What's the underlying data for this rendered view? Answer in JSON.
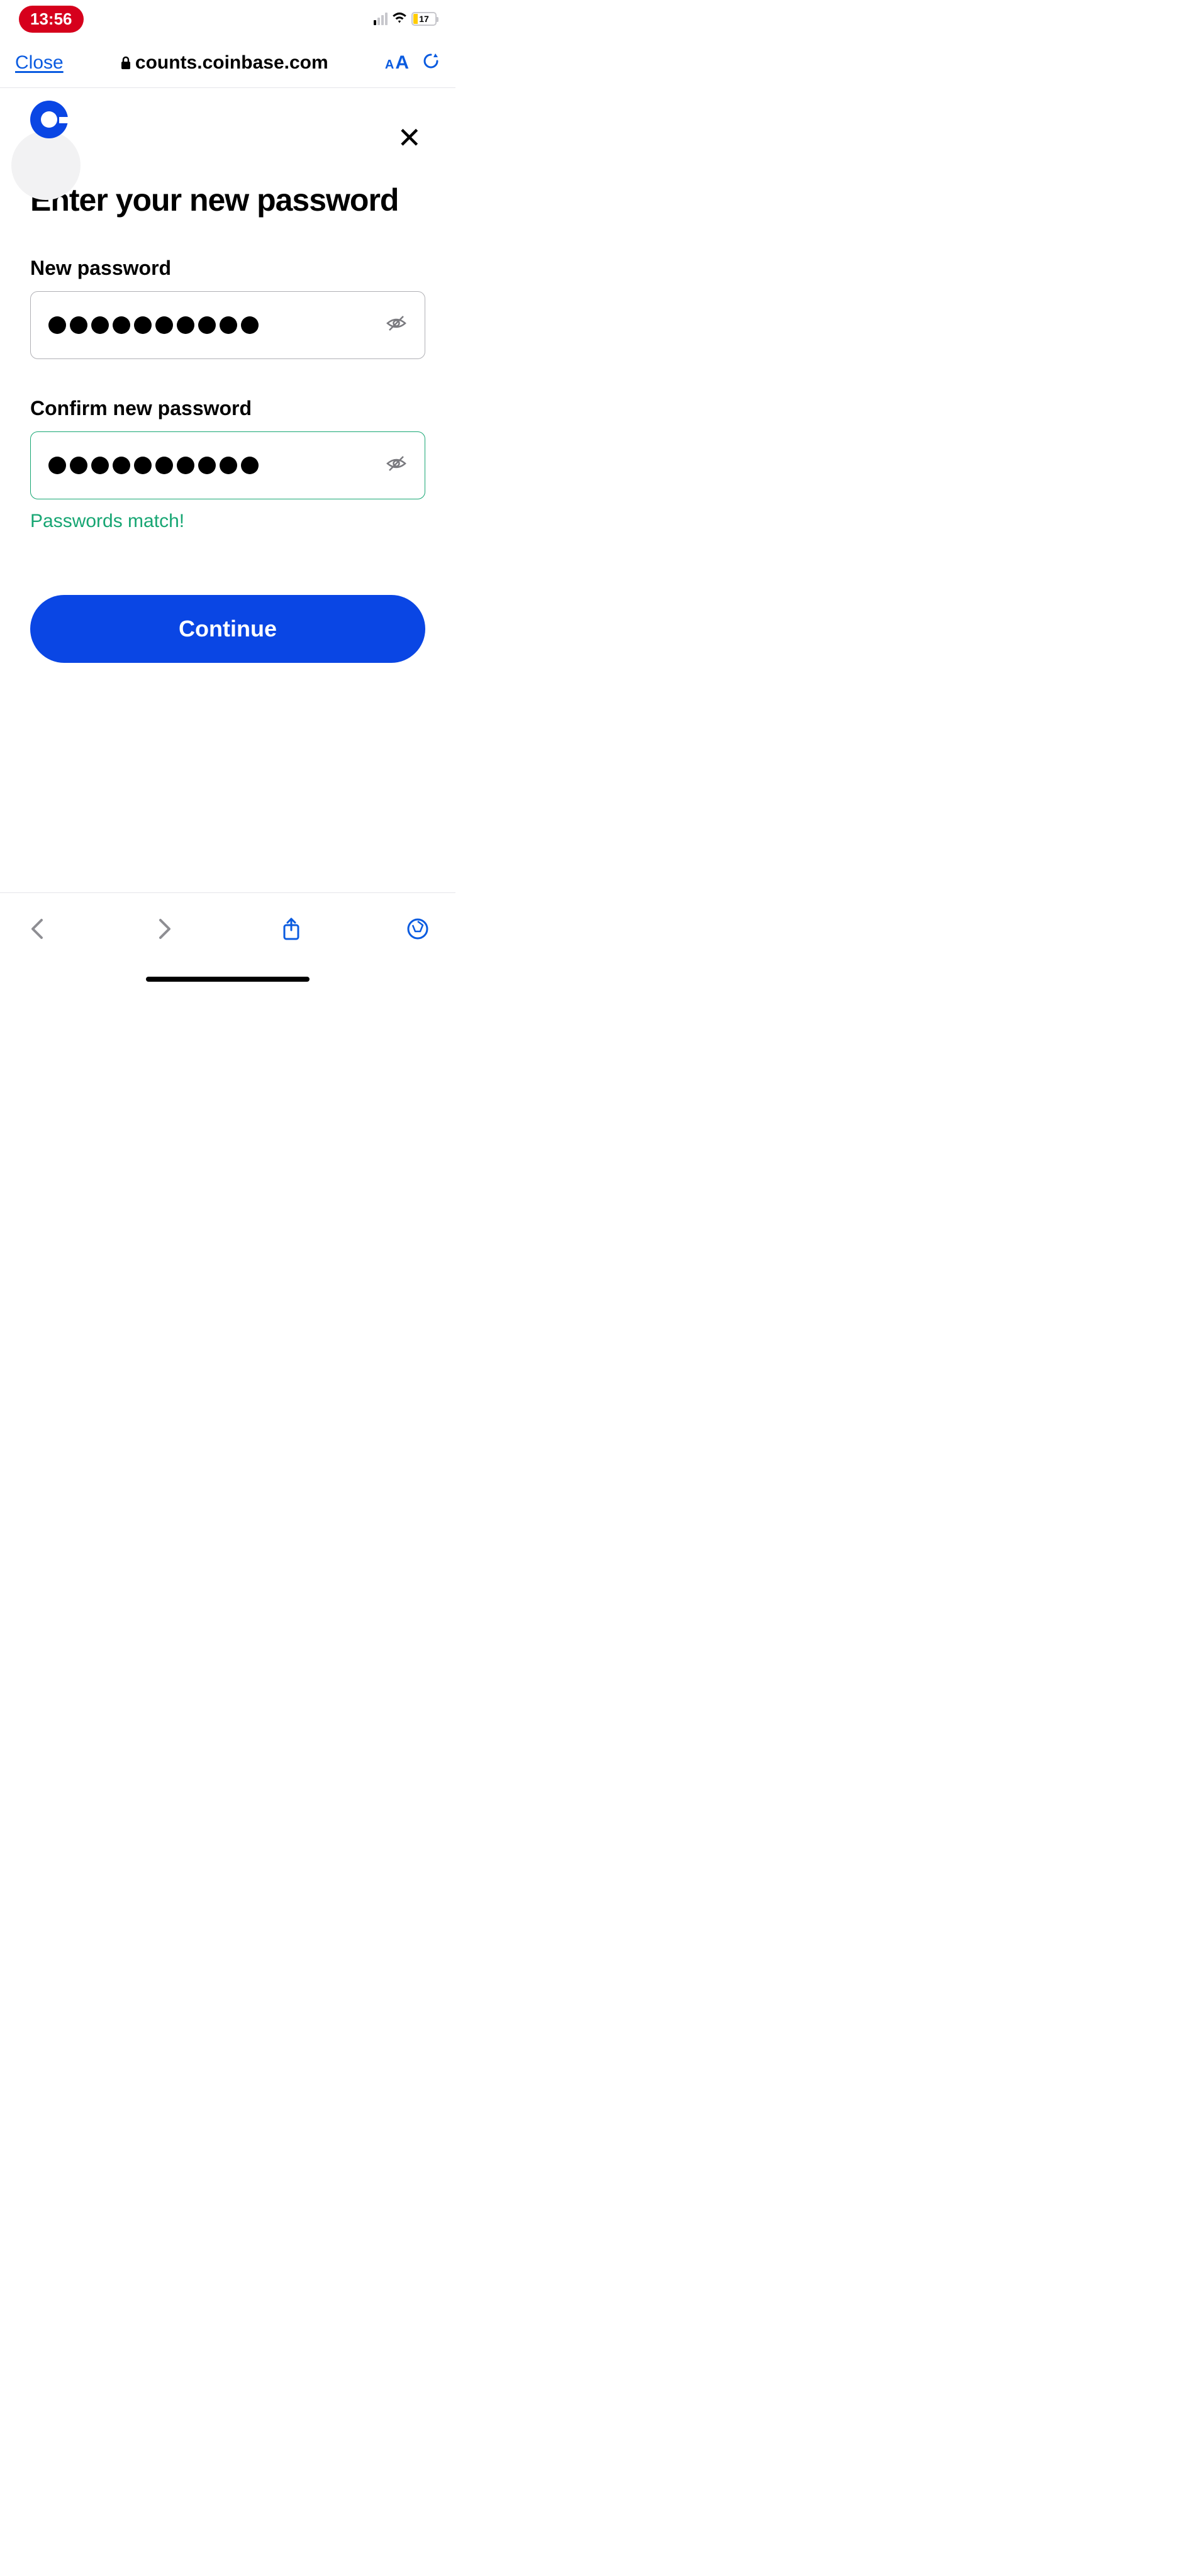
{
  "status": {
    "time": "13:56",
    "battery_pct": "17"
  },
  "browser": {
    "close": "Close",
    "url": "counts.coinbase.com",
    "aa_small": "A",
    "aa_large": "A"
  },
  "page": {
    "title": "Enter your new password",
    "new_pw_label": "New password",
    "confirm_pw_label": "Confirm new password",
    "match_msg": "Passwords match!",
    "continue": "Continue",
    "pw_dot_count": 10
  }
}
